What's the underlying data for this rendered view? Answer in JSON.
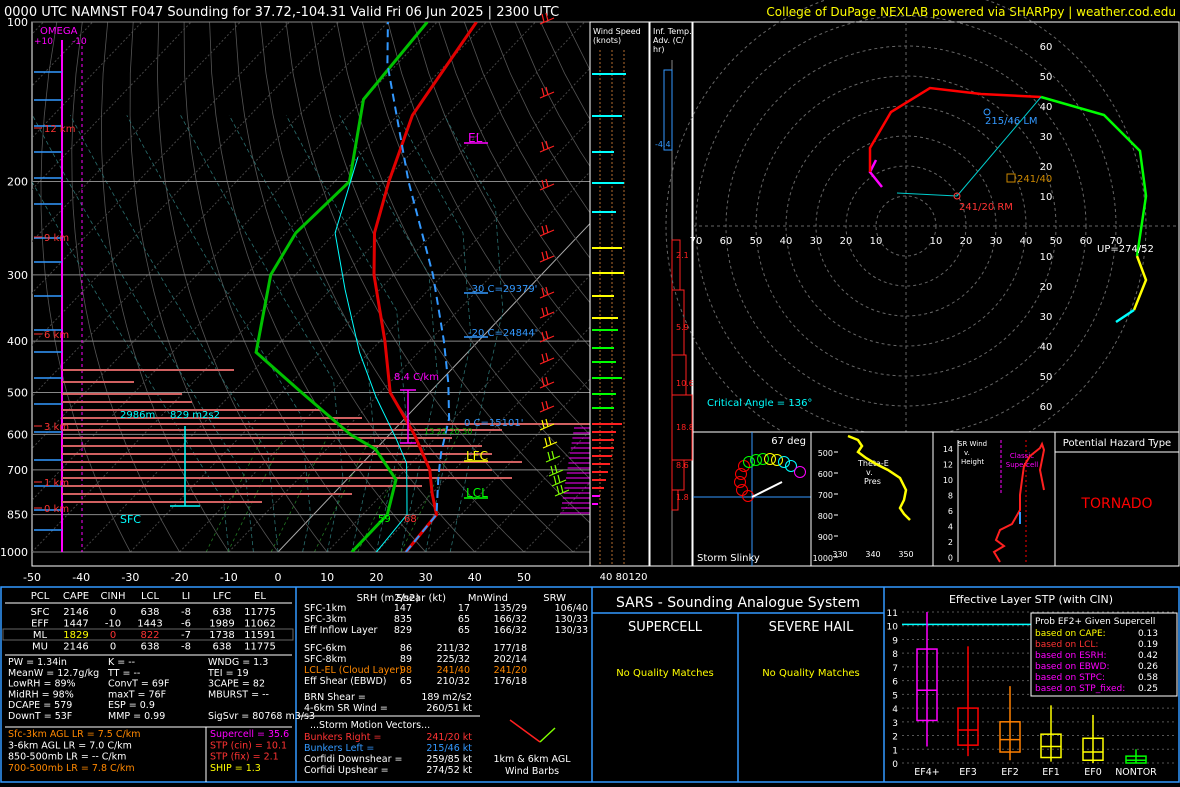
{
  "header": {
    "title": "0000 UTC NAMNST F047 Sounding for 37.72,-104.31 Valid  Fri 06 Jun 2025 | 2300 UTC",
    "credit": "College of DuPage NEXLAB powered via SHARPpy | weather.cod.edu"
  },
  "colors": {
    "temp": "#e00000",
    "dewpoint": "#00c000",
    "wetbulb": "#00ffff",
    "parcel": "#3399ff",
    "omega": "#ff00ff",
    "panel_border": "#3399ff",
    "hazard": "#ff0000",
    "grid": "#808080"
  },
  "chart_data": [
    {
      "type": "line",
      "title": "Skew-T",
      "x_ticks": [
        "-50",
        "-40",
        "-30",
        "-20",
        "-10",
        "0",
        "10",
        "20",
        "30",
        "40",
        "50"
      ],
      "xlim": [
        -50,
        50
      ],
      "pressure_ticks": [
        "100",
        "200",
        "300",
        "400",
        "500",
        "600",
        "700",
        "850",
        "1000"
      ],
      "ylim": [
        1000,
        100
      ],
      "omega_labels": [
        "OMEGA",
        "+10",
        "-10"
      ],
      "height_labels": [
        "12 km",
        "9 km",
        "6 km",
        "3 km",
        "1 km",
        "0 km"
      ],
      "annotations": {
        "el": "EL",
        "lfc": "LFC",
        "lcl": "LCL",
        "sfc": "SFC",
        "minus30": "-30 C=29379'",
        "minus20": "-20 C=24844'",
        "zero_c": "0 C=15101'",
        "lapse_rate": "8.4 C/km",
        "esrh_depth": "2986m",
        "esrh_val": "829 m2s2",
        "sfc_dew": "59",
        "sfc_temp": "68",
        "wetbulb_hgts": "13  22  26 30"
      },
      "series": [
        {
          "name": "Temperature",
          "points": [
            [
              26,
              1000
            ],
            [
              25,
              850
            ],
            [
              20,
              775
            ],
            [
              15,
              700
            ],
            [
              5,
              600
            ],
            [
              -8,
              500
            ],
            [
              -19,
              400
            ],
            [
              -34,
              300
            ],
            [
              -42,
              250
            ],
            [
              -49,
              200
            ],
            [
              -57,
              150
            ],
            [
              -62,
              100
            ]
          ]
        },
        {
          "name": "Dewpoint",
          "points": [
            [
              15,
              1000
            ],
            [
              15,
              850
            ],
            [
              13,
              800
            ],
            [
              10,
              730
            ],
            [
              0,
              640
            ],
            [
              -8,
              600
            ],
            [
              -26,
              500
            ],
            [
              -43,
              420
            ],
            [
              -55,
              300
            ],
            [
              -58,
              250
            ],
            [
              -57,
              200
            ],
            [
              -70,
              140
            ],
            [
              -72,
              100
            ]
          ]
        },
        {
          "name": "Parcel",
          "points": [
            [
              26,
              1000
            ],
            [
              25,
              850
            ],
            [
              18,
              720
            ],
            [
              14,
              650
            ],
            [
              9,
              560
            ],
            [
              2,
              480
            ],
            [
              -7,
              400
            ],
            [
              -22,
              300
            ],
            [
              -45,
              200
            ],
            [
              -72,
              120
            ],
            [
              -80,
              100
            ]
          ]
        }
      ]
    },
    {
      "type": "bar",
      "title": "Wind Speed (knots)",
      "x_ticks": [
        "40",
        "80",
        "120"
      ]
    },
    {
      "type": "bar",
      "title": "Inf. Temp. Adv. (C/hr)",
      "values": [
        "-4.4",
        "2.1",
        "5.9",
        "10.6",
        "18.8",
        "8.6",
        "1.8"
      ]
    },
    {
      "type": "line",
      "title": "Hodograph",
      "ring_labels_x": [
        "70",
        "60",
        "50",
        "40",
        "30",
        "20",
        "10",
        "10",
        "20",
        "30",
        "40",
        "50",
        "60",
        "70"
      ],
      "ring_labels_y": [
        "60",
        "50",
        "40",
        "30",
        "20",
        "10",
        "10",
        "20",
        "30",
        "40",
        "50",
        "60"
      ],
      "points_labels": {
        "lm": "215/46 LM",
        "rm": "241/20 RM",
        "mean": "241/40",
        "up": "UP=274/52"
      },
      "critical_angle": "Critical Angle = 136°"
    },
    {
      "type": "scatter",
      "title": "Storm Slinky",
      "angle": "67 deg"
    },
    {
      "type": "line",
      "title": "Theta-E v. Pres",
      "y_ticks": [
        "500",
        "600",
        "700",
        "800",
        "900",
        "1000"
      ],
      "x_ticks": [
        "330",
        "340",
        "350"
      ]
    },
    {
      "type": "line",
      "title": "SR Wind v. Height",
      "y_ticks": [
        "14",
        "12",
        "10",
        "8",
        "6",
        "4",
        "2",
        "0"
      ],
      "label": "Classic Supercell"
    },
    {
      "type": "bar",
      "title": "Effective Layer STP (with CIN)",
      "categories": [
        "EF4+",
        "EF3",
        "EF2",
        "EF1",
        "EF0",
        "NONTOR"
      ],
      "y_ticks": [
        "11",
        "10",
        "9",
        "8",
        "7",
        "6",
        "5",
        "4",
        "3",
        "2",
        "1",
        "0"
      ],
      "series": [
        {
          "name": "box",
          "values": [
            [
              1.2,
              3.1,
              5.3,
              8.3,
              11.0
            ],
            [
              0.5,
              1.3,
              2.4,
              4.0,
              8.5
            ],
            [
              0.2,
              0.8,
              1.7,
              3.0,
              5.6
            ],
            [
              0.1,
              0.4,
              1.2,
              2.1,
              4.2
            ],
            [
              0.0,
              0.2,
              0.8,
              1.8,
              3.5
            ],
            [
              0.0,
              0.0,
              0.2,
              0.5,
              1.0
            ]
          ]
        }
      ],
      "colors": [
        "#ff00ff",
        "#ff0000",
        "#ff8000",
        "#ffff00",
        "#ffff00",
        "#00ff00"
      ]
    }
  ],
  "hazard": {
    "title": "Potential Hazard Type",
    "value": "TORNADO"
  },
  "parcel_table": {
    "headers": [
      "PCL",
      "CAPE",
      "CINH",
      "LCL",
      "LI",
      "LFC",
      "EL"
    ],
    "rows": [
      [
        "SFC",
        "2146",
        "0",
        "638",
        "-8",
        "638",
        "11775"
      ],
      [
        "EFF",
        "1447",
        "-10",
        "1443",
        "-6",
        "1989",
        "11062"
      ],
      [
        "ML",
        "1829",
        "0",
        "822",
        "-7",
        "1738",
        "11591"
      ],
      [
        "MU",
        "2146",
        "0",
        "638",
        "-8",
        "638",
        "11775"
      ]
    ]
  },
  "thermo": [
    [
      "PW = 1.34in",
      "K = --",
      "WNDG = 1.3"
    ],
    [
      "MeanW = 12.7g/kg",
      "TT = --",
      "TEI = 19"
    ],
    [
      "LowRH = 89%",
      "ConvT = 69F",
      "3CAPE = 82"
    ],
    [
      "MidRH = 98%",
      "maxT = 76F",
      "MBURST = --"
    ],
    [
      "DCAPE = 579",
      "ESP = 0.9",
      ""
    ],
    [
      "DownT = 53F",
      "MMP = 0.99",
      "SigSvr = 80768 m3/s3"
    ]
  ],
  "lapse": [
    "Sfc-3km AGL LR = 7.5 C/km",
    "3-6km AGL LR = 7.0 C/km",
    "850-500mb LR = -- C/km",
    "700-500mb LR = 7.8 C/km"
  ],
  "indices": [
    "Supercell = 35.6",
    "STP (cin) = 10.1",
    "STP (fix) = 2.1",
    "SHIP = 1.3"
  ],
  "kinematic": {
    "headers": [
      "SRH (m2/s2)",
      "Shear (kt)",
      "MnWind",
      "SRW"
    ],
    "rows": [
      [
        "SFC-1km",
        "147",
        "17",
        "135/29",
        "106/40"
      ],
      [
        "SFC-3km",
        "835",
        "65",
        "166/32",
        "130/33"
      ],
      [
        "Eff Inflow Layer",
        "829",
        "65",
        "166/32",
        "130/33"
      ],
      [
        "",
        "",
        "",
        "",
        ""
      ],
      [
        "SFC-6km",
        "86",
        "211/32",
        "177/18",
        ""
      ],
      [
        "SFC-8km",
        "89",
        "225/32",
        "202/14",
        ""
      ],
      [
        "LCL-EL (Cloud Layer)",
        "98",
        "241/40",
        "241/20",
        ""
      ],
      [
        "Eff Shear (EBWD)",
        "65",
        "210/32",
        "176/18",
        ""
      ]
    ],
    "brn": "BRN Shear =",
    "brn_val": "189 m2/s2",
    "srwind": "4-6km SR Wind =",
    "srwind_val": "260/51 kt",
    "storm_title": "...Storm Motion Vectors...",
    "storm": [
      [
        "Bunkers Right =",
        "241/20 kt"
      ],
      [
        "Bunkers Left =",
        "215/46 kt"
      ],
      [
        "Corfidi Downshear =",
        "259/85 kt"
      ],
      [
        "Corfidi Upshear =",
        "274/52 kt"
      ]
    ],
    "barb_label": "1km & 6km AGL Wind Barbs"
  },
  "sars": {
    "title": "SARS - Sounding Analogue System",
    "supercell": "SUPERCELL",
    "hail": "SEVERE HAIL",
    "no_match_1": "No Quality Matches",
    "no_match_2": "No Quality Matches"
  },
  "stp_prob": {
    "title": "Prob EF2+ Given Supercell",
    "rows": [
      [
        "based on CAPE:",
        "0.13"
      ],
      [
        "based on LCL:",
        "0.19"
      ],
      [
        "based on ESRH:",
        "0.42"
      ],
      [
        "based on EBWD:",
        "0.26"
      ],
      [
        "based on STPC:",
        "0.58"
      ],
      [
        "based on STP_fixed:",
        "0.25"
      ]
    ]
  }
}
